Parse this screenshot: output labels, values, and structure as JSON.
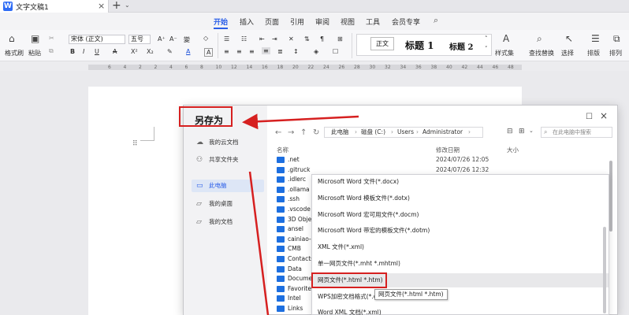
{
  "titlebar": {
    "app_logo": "W",
    "tab_title": "文字文稿1",
    "close": "×",
    "add": "+",
    "dropdown": "⌄"
  },
  "menu": {
    "items": [
      "开始",
      "插入",
      "页面",
      "引用",
      "审阅",
      "视图",
      "工具",
      "会员专享"
    ],
    "active": "开始"
  },
  "ribbon": {
    "format_painter": "格式刷",
    "paste": "粘贴",
    "font_name": "宋体 (正文)",
    "font_size": "五号",
    "styles": [
      "正文",
      "标题 1",
      "标题 2"
    ],
    "style_set": "样式集",
    "find_replace": "查找替换",
    "select": "选择",
    "layout": "排版",
    "arrange": "排列"
  },
  "ruler": {
    "numbers": [
      "6",
      "4",
      "2",
      "2",
      "4",
      "6",
      "8",
      "10",
      "12",
      "14",
      "16",
      "18",
      "20",
      "22",
      "24",
      "26",
      "28",
      "30",
      "32",
      "34",
      "36",
      "38",
      "40",
      "42",
      "44",
      "46",
      "48"
    ]
  },
  "dialog": {
    "title": "另存为",
    "sidebar": [
      {
        "label": "我的云文档",
        "icon": "cloud-icon"
      },
      {
        "label": "共享文件夹",
        "icon": "share-icon"
      },
      {
        "label": "此电脑",
        "icon": "computer-icon",
        "selected": true
      },
      {
        "label": "我的桌面",
        "icon": "folder-icon"
      },
      {
        "label": "我的文档",
        "icon": "folder-icon"
      }
    ],
    "path": [
      "此电脑",
      "磁盘 (C:)",
      "Users",
      "Administrator"
    ],
    "search_placeholder": "在此电脑中搜索",
    "columns": {
      "name": "名称",
      "modified": "修改日期",
      "size": "大小"
    },
    "files": [
      {
        "name": ".net",
        "date": "2024/07/26 12:05"
      },
      {
        "name": ".gitruck",
        "date": "2024/07/26 12:32"
      },
      {
        "name": ".idlerc",
        "date": ""
      },
      {
        "name": ".ollama",
        "date": ""
      },
      {
        "name": ".ssh",
        "date": ""
      },
      {
        "name": ".vscode",
        "date": ""
      },
      {
        "name": "3D Objec",
        "date": ""
      },
      {
        "name": "ansel",
        "date": ""
      },
      {
        "name": "cainiao-x-",
        "date": ""
      },
      {
        "name": "CMB",
        "date": ""
      },
      {
        "name": "Contacts",
        "date": ""
      },
      {
        "name": "Data",
        "date": ""
      },
      {
        "name": "Documen",
        "date": ""
      },
      {
        "name": "Favorites",
        "date": ""
      },
      {
        "name": "Intel",
        "date": ""
      },
      {
        "name": "Links",
        "date": ""
      }
    ],
    "file_types": [
      "Microsoft Word 文件(*.docx)",
      "Microsoft Word 模板文件(*.dotx)",
      "Microsoft Word 宏可用文件(*.docm)",
      "Microsoft Word 带宏的模板文件(*.dotm)",
      "XML 文件(*.xml)",
      "单一网页文件(*.mht *.mhtml)",
      "网页文件(*.html *.htm)",
      "WPS加密文档格式(*.do",
      "Word XML 文档(*.xml)"
    ],
    "tooltip": "网页文件(*.html *.htm)"
  },
  "colors": {
    "accent": "#2a5ee8",
    "annotation": "#d62020",
    "folder": "#1d6fe0"
  }
}
